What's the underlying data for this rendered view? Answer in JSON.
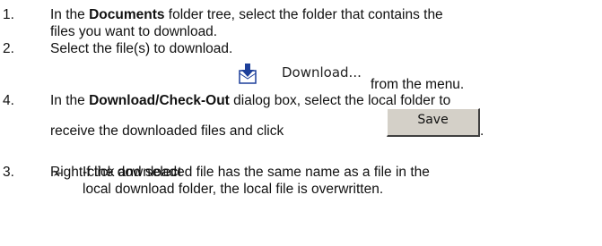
{
  "steps": [
    {
      "number": "1.",
      "line1_pre": "In the ",
      "line1_bold": "Documents",
      "line1_post": " folder tree, select the folder that contains the",
      "line2": "files you want to download."
    },
    {
      "number": "2.",
      "text": "Select the file(s) to download."
    },
    {
      "number": "3.",
      "pre": "Right-click and select ",
      "menu_item_label": "Download...",
      "menu_item_icon": "download-icon",
      "post": "from the menu."
    },
    {
      "number": "4.",
      "line1_pre": "In the ",
      "line1_bold": "Download/Check-Out",
      "line1_post": " dialog box, select the local folder to",
      "line2_pre": "receive the downloaded files and click",
      "button_label": "Save",
      "line2_post": "."
    }
  ],
  "note": {
    "bullet": "➢",
    "line1": "If the downloaded file has the same name as a file in the",
    "line2": "local download folder, the local file is overwritten."
  }
}
